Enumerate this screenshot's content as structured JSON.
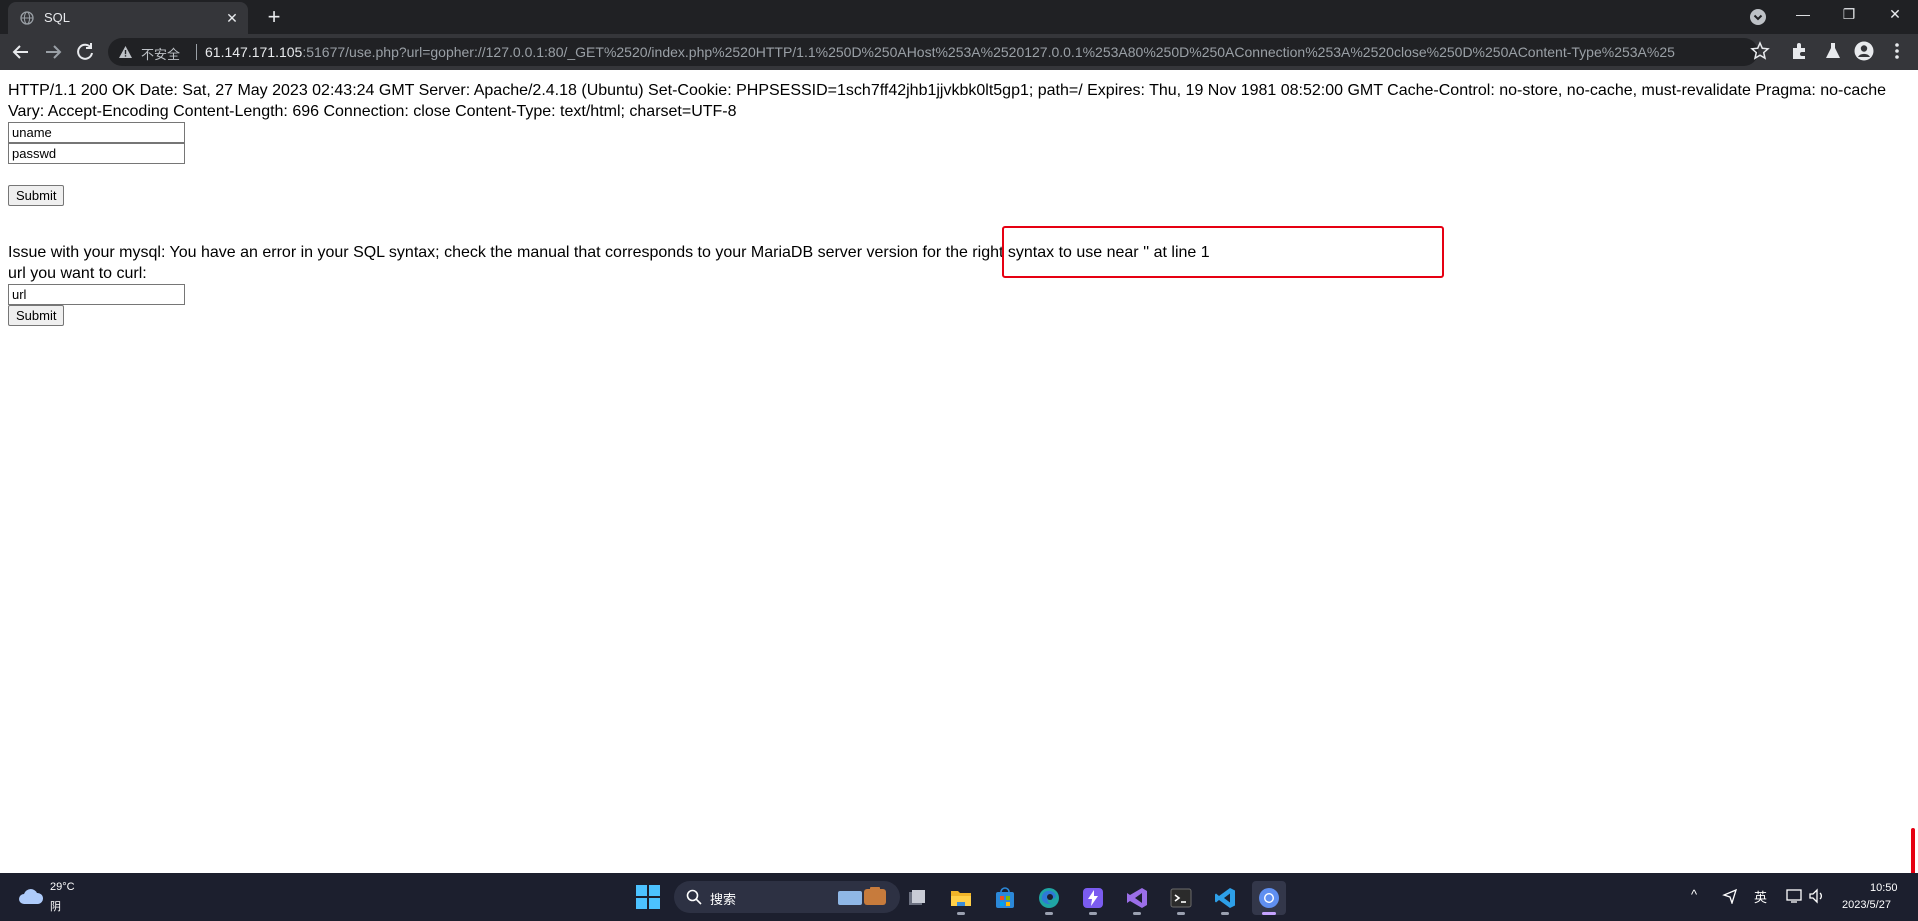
{
  "browser": {
    "tab_title": "SQL",
    "tab_close_glyph": "✕",
    "new_tab_glyph": "+",
    "window_controls": {
      "minimize": "—",
      "restore": "❐",
      "close": "✕"
    },
    "security_label": "不安全",
    "url_host": "61.147.171.105",
    "url_rest": ":51677/use.php?url=gopher://127.0.0.1:80/_GET%2520/index.php%2520HTTP/1.1%250D%250AHost%253A%2520127.0.0.1%253A80%250D%250AConnection%253A%2520close%250D%250AContent-Type%253A%25",
    "icons": [
      "back-icon",
      "forward-icon",
      "reload-icon",
      "warning-icon",
      "star-icon",
      "extensions-icon",
      "flask-icon",
      "profile-icon",
      "menu-icon"
    ]
  },
  "page": {
    "http_response": "HTTP/1.1 200 OK Date: Sat, 27 May 2023 02:43:24 GMT Server: Apache/2.4.18 (Ubuntu) Set-Cookie: PHPSESSID=1sch7ff42jhb1jjvkbk0lt5gp1; path=/ Expires: Thu, 19 Nov 1981 08:52:00 GMT Cache-Control: no-store, no-cache, must-revalidate Pragma: no-cache Vary: Accept-Encoding Content-Length: 696 Connection: close Content-Type: text/html; charset=UTF-8",
    "uname_value": "uname",
    "passwd_value": "passwd",
    "login_submit": "Submit",
    "error_message": "Issue with your mysql: You have an error in your SQL syntax; check the manual that corresponds to your MariaDB server version for the right syntax to use near '' at line 1",
    "curl_label": "url you want to curl:",
    "url_value": "url",
    "curl_submit": "Submit",
    "highlight_color": "#e60012"
  },
  "taskbar": {
    "weather_temp": "29°C",
    "weather_desc": "阴",
    "search_placeholder": "搜索",
    "apps": [
      "file-manager-icon",
      "file-explorer-icon",
      "store-icon",
      "edge-icon",
      "power-automate-icon",
      "visual-studio-icon",
      "terminal-icon",
      "vscode-icon",
      "chrome-icon"
    ],
    "tray_chevron": "^",
    "ime": "英",
    "time": "10:50",
    "date": "2023/5/27"
  }
}
